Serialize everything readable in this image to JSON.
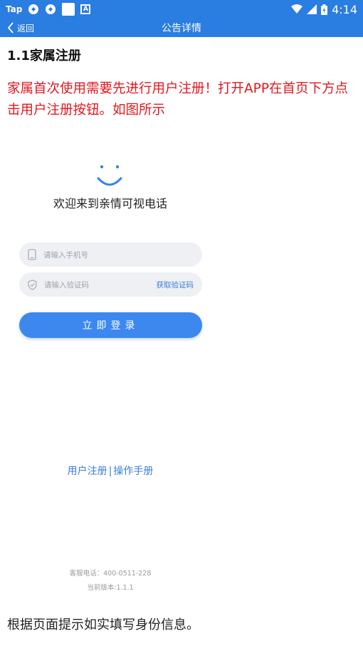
{
  "statusbar": {
    "carrier": "Tap",
    "app_badge": "A",
    "time": "4:14"
  },
  "navbar": {
    "back_label": "返回",
    "title": "公告详情"
  },
  "article": {
    "heading": "1.1家属注册",
    "intro": "家属首次使用需要先进行用户注册！打开APP在首页下方点击用户注册按钮。如图所示",
    "outro": "根据页面提示如实填写身份信息。"
  },
  "screenshot": {
    "welcome": "欢迎来到亲情可视电话",
    "phone_placeholder": "请输入手机号",
    "code_placeholder": "请输入验证码",
    "get_code": "获取验证码",
    "login": "立即登录",
    "register": "用户注册",
    "separator": "|",
    "manual": "操作手册",
    "service_phone": "客服电话：400-0511-228",
    "version": "当前版本:1.1.1"
  },
  "colors": {
    "nav_bar": "#2a7de1",
    "intro_text": "#e0181e",
    "accent": "#3d88ef"
  },
  "icons": [
    "chevron-left-icon",
    "wifi-icon",
    "signal-icon",
    "battery-icon",
    "phone-icon",
    "shield-icon",
    "smile-icon"
  ]
}
